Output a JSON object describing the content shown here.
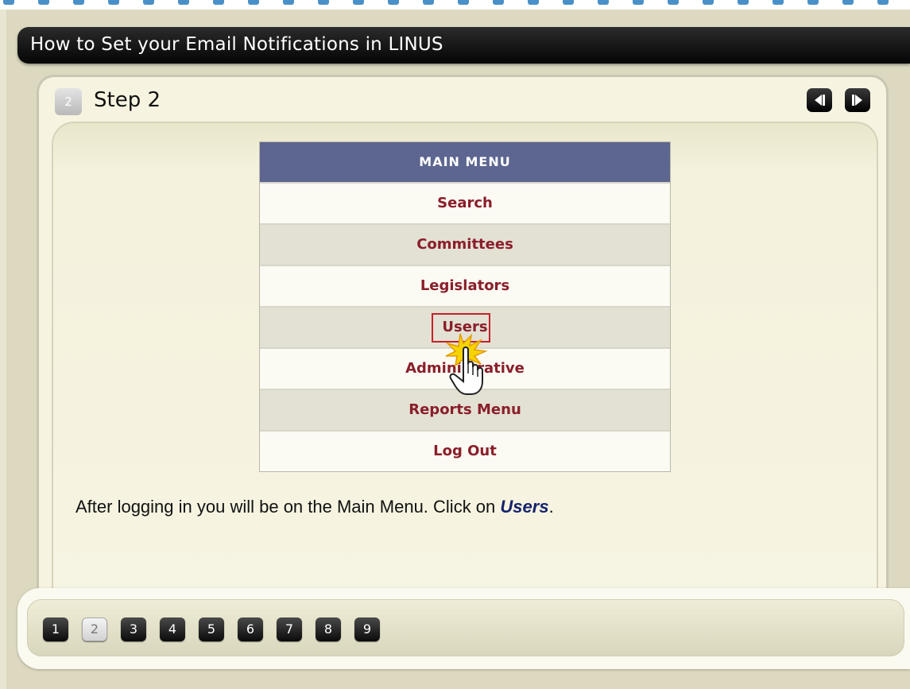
{
  "window": {
    "title": "How to Set your Email Notifications in LINUS"
  },
  "step": {
    "number": "2",
    "title": "Step 2"
  },
  "navigation": {
    "prev_icon": "prev-step-icon",
    "next_icon": "next-step-icon"
  },
  "main_menu": {
    "header": "MAIN MENU",
    "items": [
      {
        "label": "Search"
      },
      {
        "label": "Committees"
      },
      {
        "label": "Legislators"
      },
      {
        "label": "Users"
      },
      {
        "label": "Administrative"
      },
      {
        "label": "Reports Menu"
      },
      {
        "label": "Log Out"
      }
    ]
  },
  "instruction": {
    "before": "After logging in you will be on the Main Menu.  Click on ",
    "emphasis": "Users",
    "after": "."
  },
  "pagination": {
    "pages": [
      "1",
      "2",
      "3",
      "4",
      "5",
      "6",
      "7",
      "8",
      "9"
    ],
    "active": "2"
  },
  "colors": {
    "accent_header": "#5c6690",
    "menu_text": "#8a1e2a",
    "highlight": "#c4212b",
    "dashes": "#4a90c8"
  }
}
